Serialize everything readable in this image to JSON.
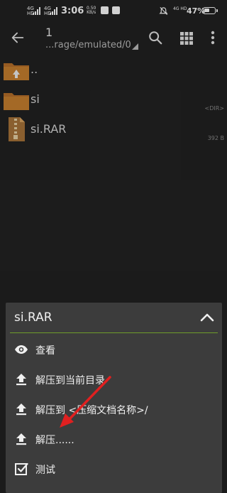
{
  "statusbar": {
    "network1": "4G HD",
    "network2": "4G HD",
    "time": "3:06",
    "speed_value": "0.50",
    "speed_unit": "KB/s",
    "network3": "4G HD",
    "battery_pct": "47%",
    "battery_level": 0.47
  },
  "toolbar": {
    "title": "1",
    "path": "...rage/emulated/0"
  },
  "files": [
    {
      "name": "..",
      "meta": "",
      "icon": "folder-up-icon"
    },
    {
      "name": "si",
      "meta": "<DIR>",
      "icon": "folder-icon"
    },
    {
      "name": "si.RAR",
      "meta": "392 B",
      "icon": "archive-icon"
    }
  ],
  "sheet": {
    "title": "si.RAR",
    "items": [
      {
        "label": "查看",
        "icon": "eye-icon"
      },
      {
        "label": "解压到当前目录",
        "icon": "upload-icon"
      },
      {
        "label": "解压到  <压缩文档名称>/",
        "icon": "upload-icon"
      },
      {
        "label": "解压......",
        "icon": "upload-icon"
      },
      {
        "label": "测试",
        "icon": "checkbox-icon"
      }
    ]
  },
  "colors": {
    "background": "#222222",
    "sheet": "#3c3c3c",
    "accent_rule": "#6f9c2a",
    "folder": "#c07a2a",
    "annotation_arrow": "#e02020"
  }
}
